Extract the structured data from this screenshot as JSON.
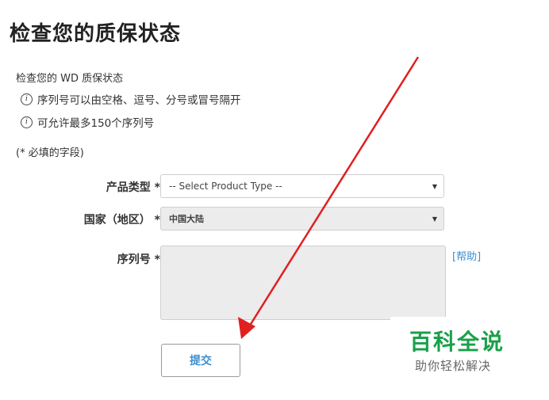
{
  "page": {
    "title": "检查您的质保状态",
    "intro": "检查您的 WD 质保状态",
    "notes": [
      "序列号可以由空格、逗号、分号或冒号隔开",
      "可允许最多150个序列号"
    ],
    "info_glyph": "i",
    "required_note": "(* 必填的字段)"
  },
  "form": {
    "product_type_label": "产品类型 *",
    "product_type_value": "-- Select Product Type --",
    "country_label": "国家（地区） *",
    "country_value": "中国大陆",
    "serial_label": "序列号 *",
    "help_link": "[帮助]",
    "submit_label": "提交",
    "caret": "▼"
  },
  "watermark": {
    "title": "百科全说",
    "subtitle": "助你轻松解决"
  },
  "colors": {
    "accent_link": "#3a8fd0",
    "annotation_arrow": "#e02020",
    "watermark_green": "#1aa04a"
  }
}
